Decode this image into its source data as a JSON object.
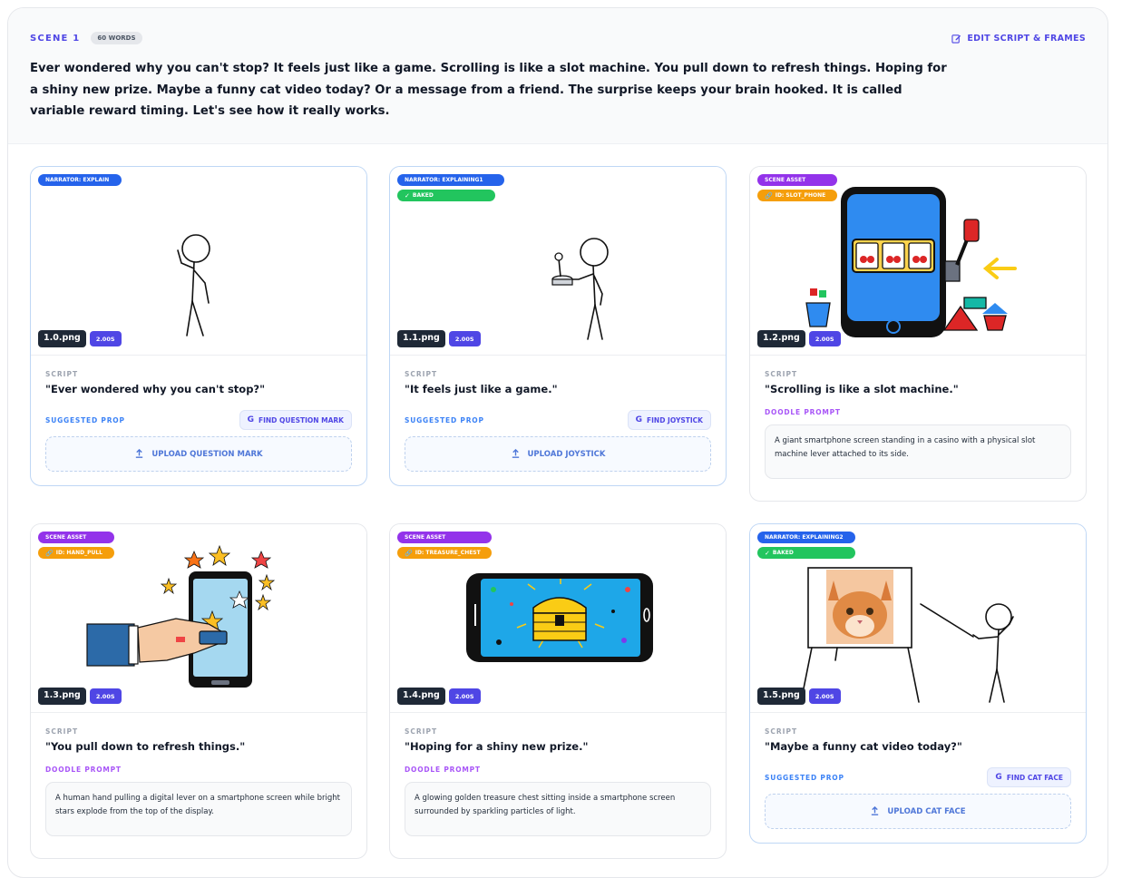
{
  "scene": {
    "label": "SCENE 1",
    "word_count": "60 WORDS",
    "edit_label": "EDIT SCRIPT & FRAMES",
    "narration": "Ever wondered why you can't stop? It feels just like a game. Scrolling is like a slot machine. You pull down to refresh things. Hoping for a shiny new prize. Maybe a funny cat video today? Or a message from a friend. The surprise keeps your brain hooked. It is called variable reward timing. Let's see how it really works."
  },
  "labels": {
    "script": "SCRIPT",
    "suggested_prop": "SUGGESTED PROP",
    "doodle_prompt": "DOODLE PROMPT"
  },
  "frames": [
    {
      "tag1": "NARRATOR: EXPLAIN",
      "file": "1.0.png",
      "duration": "2.00S",
      "script": "\"Ever wondered why you can't stop?\"",
      "find": "FIND QUESTION MARK",
      "upload": "UPLOAD QUESTION MARK"
    },
    {
      "tag1": "NARRATOR: EXPLAINING1",
      "tag2": "BAKED",
      "file": "1.1.png",
      "duration": "2.00S",
      "script": "\"It feels just like a game.\"",
      "find": "FIND JOYSTICK",
      "upload": "UPLOAD JOYSTICK"
    },
    {
      "tag1": "SCENE ASSET",
      "tag2": "ID: SLOT_PHONE",
      "file": "1.2.png",
      "duration": "2.00S",
      "script": "\"Scrolling is like a slot machine.\"",
      "doodle": "A giant smartphone screen standing in a casino with a physical slot machine lever attached to its side."
    },
    {
      "tag1": "SCENE ASSET",
      "tag2": "ID: HAND_PULL",
      "file": "1.3.png",
      "duration": "2.00S",
      "script": "\"You pull down to refresh things.\"",
      "doodle": "A human hand pulling a digital lever on a smartphone screen while bright stars explode from the top of the display."
    },
    {
      "tag1": "SCENE ASSET",
      "tag2": "ID: TREASURE_CHEST",
      "file": "1.4.png",
      "duration": "2.00S",
      "script": "\"Hoping for a shiny new prize.\"",
      "doodle": "A glowing golden treasure chest sitting inside a smartphone screen surrounded by sparkling particles of light."
    },
    {
      "tag1": "NARRATOR: EXPLAINING2",
      "tag2": "BAKED",
      "file": "1.5.png",
      "duration": "2.00S",
      "script": "\"Maybe a funny cat video today?\"",
      "find": "FIND CAT FACE",
      "upload": "UPLOAD CAT FACE"
    }
  ],
  "colors": {
    "accent": "#4f46e5",
    "narrator_tag": "#2563eb",
    "asset_tag": "#9333ea",
    "id_tag": "#f59e0b",
    "baked_tag": "#22c55e"
  }
}
